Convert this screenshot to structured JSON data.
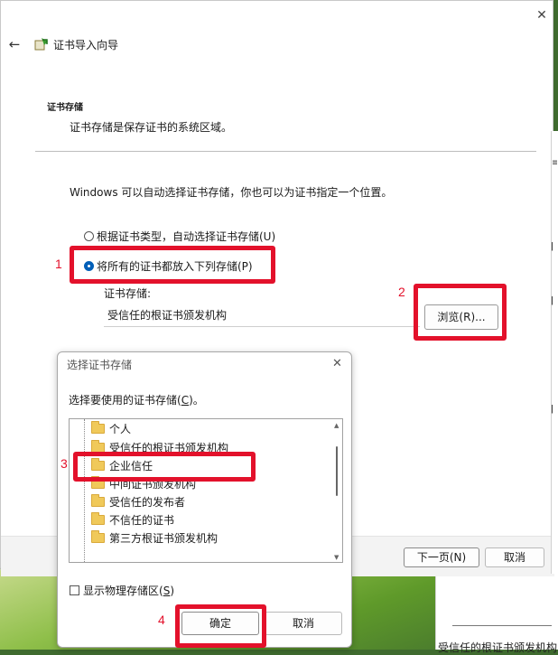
{
  "wizard": {
    "title": "证书导入向导",
    "heading": "证书存储",
    "subheading": "证书存储是保存证书的系统区域。",
    "info": "Windows 可以自动选择证书存储，你也可以为证书指定一个位置。",
    "radio_auto": "根据证书类型，自动选择证书存储(U)",
    "radio_manual": "将所有的证书都放入下列存储(P)",
    "store_label": "证书存储:",
    "store_value": "受信任的根证书颁发机构",
    "browse_label": "浏览(R)...",
    "next_label": "下一页(N)",
    "cancel_label": "取消",
    "icons": {
      "back": "back-arrow-icon",
      "close": "close-icon",
      "cert": "certificate-icon"
    }
  },
  "dialog": {
    "title": "选择证书存储",
    "prompt_pre": "选择要使用的证书存储(",
    "prompt_key": "C",
    "prompt_post": ")。",
    "items": [
      "个人",
      "受信任的根证书颁发机构",
      "企业信任",
      "中间证书颁发机构",
      "受信任的发布者",
      "不信任的证书",
      "第三方根证书颁发机构"
    ],
    "selected_index": 1,
    "show_physical_pre": "显示物理存储区(",
    "show_physical_key": "S",
    "show_physical_post": ")",
    "ok_label": "确定",
    "cancel_label": "取消"
  },
  "annotations": {
    "labels": [
      "1",
      "2",
      "3",
      "4"
    ],
    "color": "#e3112b"
  },
  "background": {
    "partial_window_text": "受信任的根证书颁发机构"
  },
  "colors": {
    "accent": "#005fb8",
    "annotation": "#e3112b"
  }
}
